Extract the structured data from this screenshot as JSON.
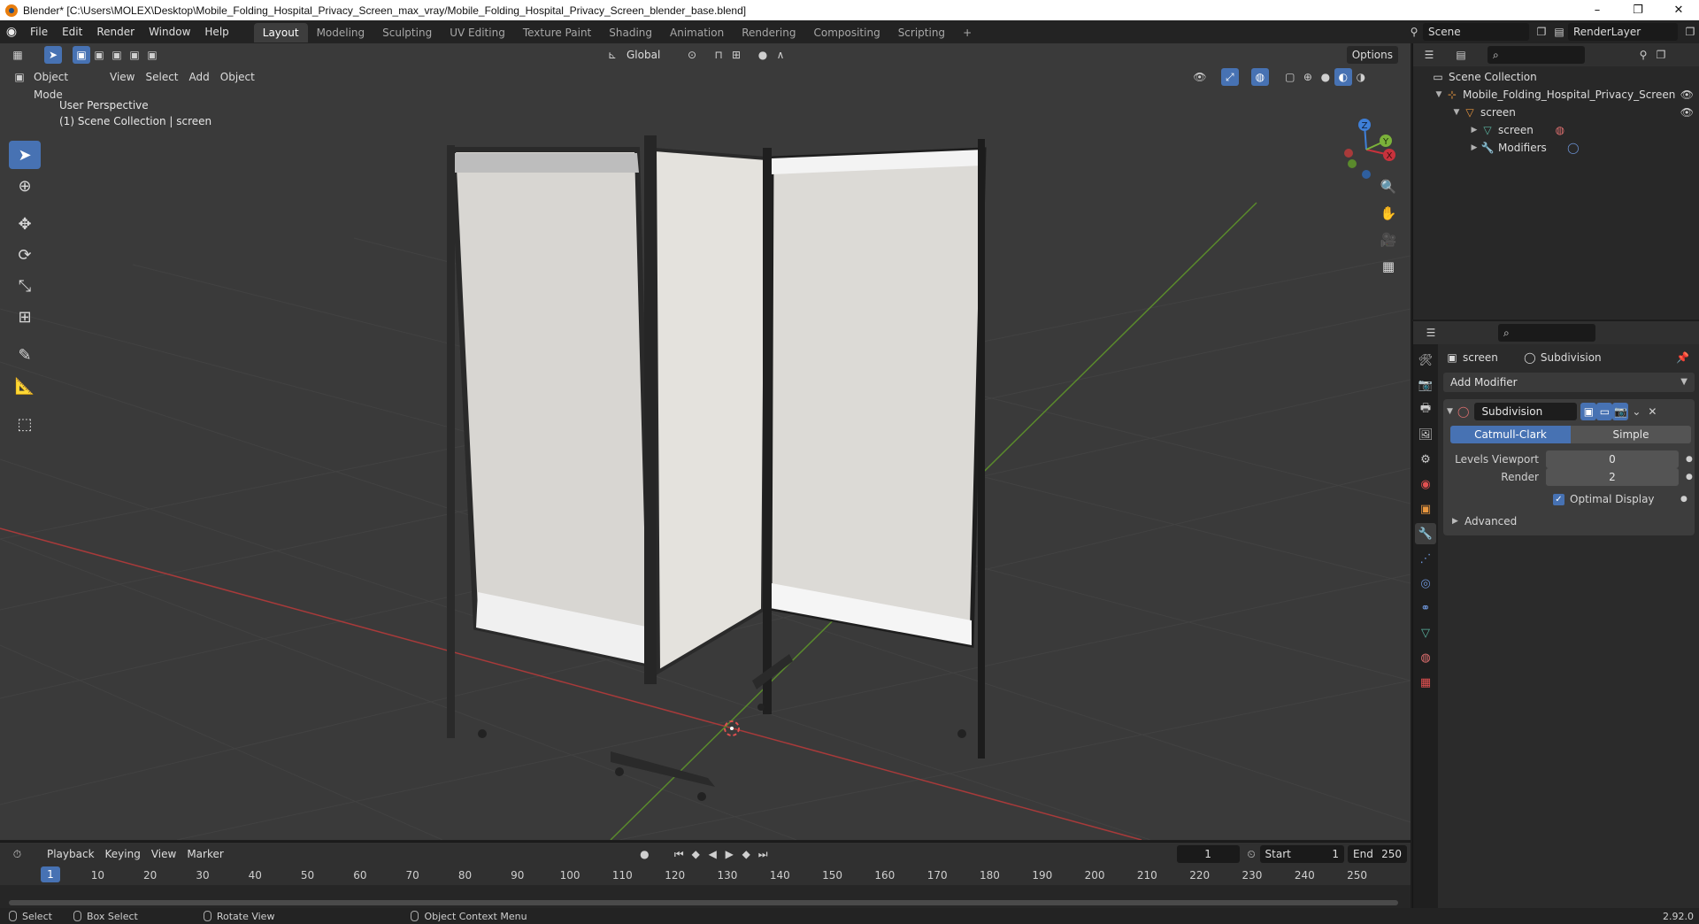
{
  "window": {
    "title": "Blender* [C:\\Users\\MOLEX\\Desktop\\Mobile_Folding_Hospital_Privacy_Screen_max_vray/Mobile_Folding_Hospital_Privacy_Screen_blender_base.blend]",
    "minimize": "–",
    "maximize": "❐",
    "close": "✕"
  },
  "menu": [
    "File",
    "Edit",
    "Render",
    "Window",
    "Help"
  ],
  "workspaces": [
    "Layout",
    "Modeling",
    "Sculpting",
    "UV Editing",
    "Texture Paint",
    "Shading",
    "Animation",
    "Rendering",
    "Compositing",
    "Scripting"
  ],
  "workspace_add": "+",
  "scene_field": "Scene",
  "renderlayer_field": "RenderLayer",
  "viewport": {
    "mode": "Object Mode",
    "menus": [
      "View",
      "Select",
      "Add",
      "Object"
    ],
    "orientation": "Global",
    "options": "Options",
    "perspective": "User Perspective",
    "collection_info": "(1) Scene Collection | screen",
    "gizmo": {
      "x": "X",
      "y": "Y",
      "z": "Z"
    }
  },
  "outliner": {
    "root": "Scene Collection",
    "collection": "Mobile_Folding_Hospital_Privacy_Screen",
    "object": "screen",
    "mesh": "screen",
    "modifiers": "Modifiers"
  },
  "properties": {
    "crumb_object": "screen",
    "crumb_modifier": "Subdivision",
    "add_modifier": "Add Modifier",
    "modifier_name": "Subdivision",
    "mode_a": "Catmull-Clark",
    "mode_b": "Simple",
    "levels_viewport_label": "Levels Viewport",
    "levels_viewport_value": "0",
    "render_label": "Render",
    "render_value": "2",
    "optimal_display": "Optimal Display",
    "advanced": "Advanced"
  },
  "timeline": {
    "menus": [
      "Playback",
      "Keying",
      "View",
      "Marker"
    ],
    "current_frame": "1",
    "start_label": "Start",
    "start_value": "1",
    "end_label": "End",
    "end_value": "250",
    "ticks": [
      "1",
      "10",
      "20",
      "30",
      "40",
      "50",
      "60",
      "70",
      "80",
      "90",
      "100",
      "110",
      "120",
      "130",
      "140",
      "150",
      "160",
      "170",
      "180",
      "190",
      "200",
      "210",
      "220",
      "230",
      "240",
      "250"
    ]
  },
  "statusbar": {
    "select": "Select",
    "box_select": "Box Select",
    "rotate_view": "Rotate View",
    "context_menu": "Object Context Menu",
    "version": "2.92.0"
  },
  "colors": {
    "accent": "#4772b3",
    "x_axis": "#c8323c",
    "y_axis": "#7bb23a",
    "z_axis": "#3e7fd8"
  }
}
